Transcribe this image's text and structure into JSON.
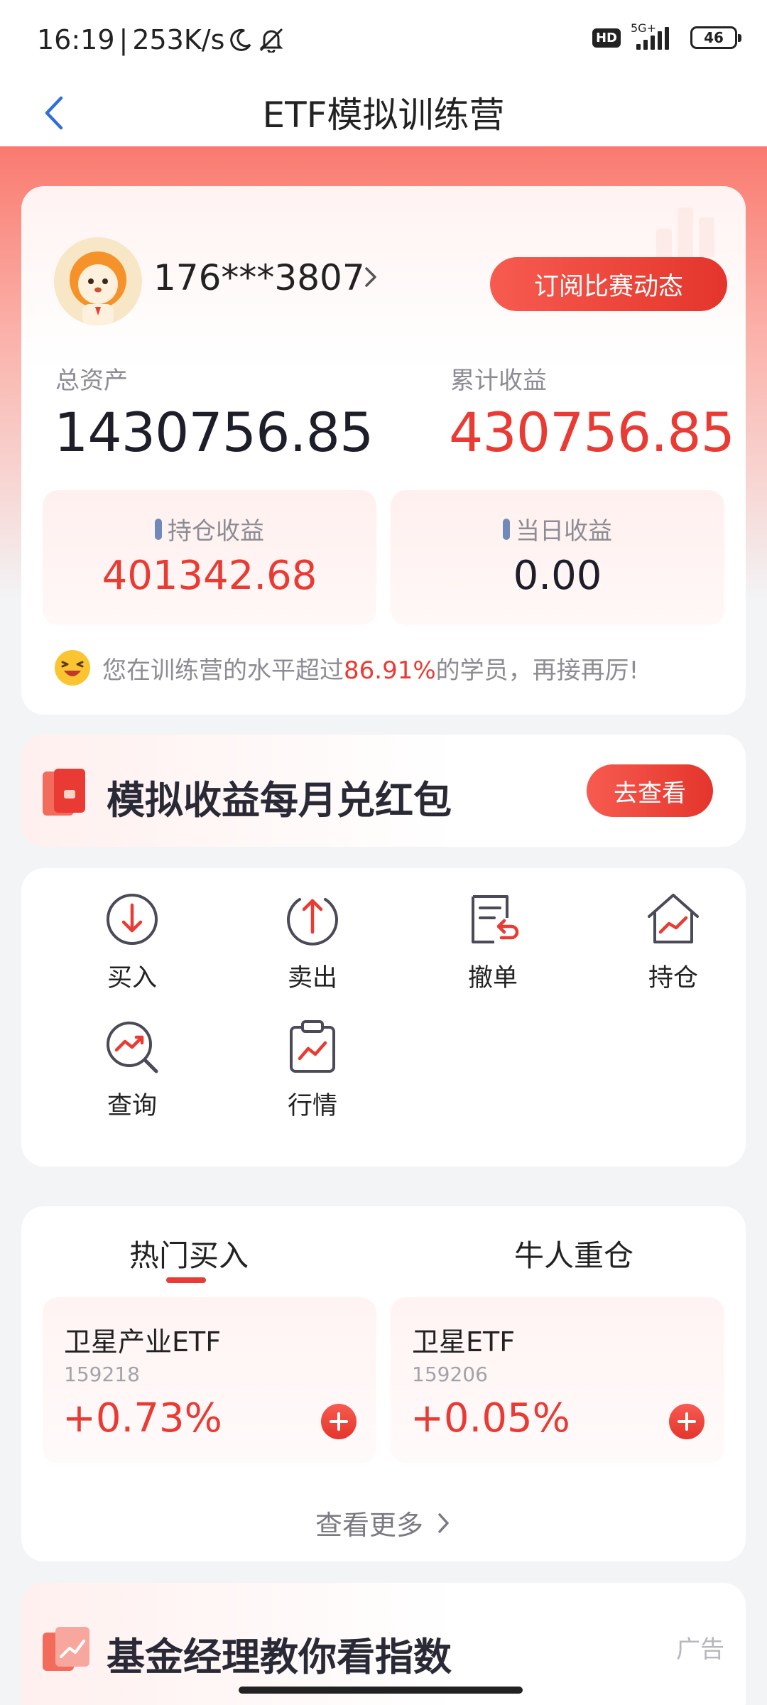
{
  "status_bar": {
    "time": "16:19",
    "speed": "253K/s",
    "network": "5G+",
    "hd_label": "HD",
    "battery": "46"
  },
  "nav": {
    "title": "ETF模拟训练营"
  },
  "account": {
    "user_id": "176***3807",
    "subscribe_label": "订阅比赛动态",
    "total_assets_label": "总资产",
    "total_assets_value": "1430756.85",
    "cumulative_income_label": "累计收益",
    "cumulative_income_value": "430756.85",
    "position_income_label": "持仓收益",
    "position_income_value": "401342.68",
    "daily_income_label": "当日收益",
    "daily_income_value": "0.00",
    "rank_prefix": "您在训练营的水平超过",
    "rank_percent": "86.91%",
    "rank_suffix": "的学员，再接再厉!"
  },
  "red_packet": {
    "title": "模拟收益每月兑红包",
    "button": "去查看"
  },
  "functions": {
    "buy": "买入",
    "sell": "卖出",
    "cancel": "撤单",
    "position": "持仓",
    "query": "查询",
    "market": "行情"
  },
  "hot": {
    "tab_active": "热门买入",
    "tab_other": "牛人重仓",
    "funds": [
      {
        "name": "卫星产业ETF",
        "code": "159218",
        "change": "+0.73%"
      },
      {
        "name": "卫星ETF",
        "code": "159206",
        "change": "+0.05%"
      }
    ],
    "more": "查看更多"
  },
  "ad": {
    "title": "基金经理教你看指数",
    "badge": "广告"
  },
  "colors": {
    "accent_red": "#e93b33",
    "header_gradient": "#f97a6f",
    "muted_text": "#8c8c94"
  }
}
